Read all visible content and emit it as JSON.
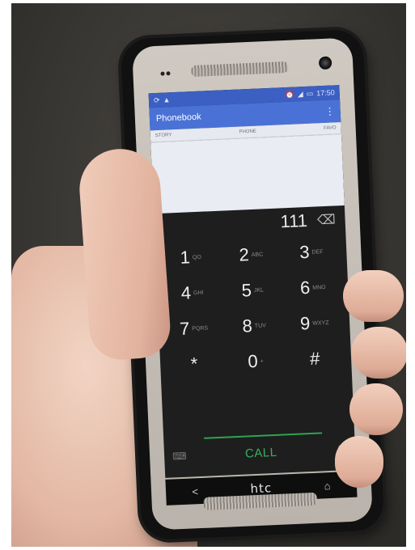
{
  "status_bar": {
    "left_icons": [
      "sync-icon",
      "warning-icon"
    ],
    "time": "17:50"
  },
  "app": {
    "title": "Phonebook",
    "menu_icon": "overflow-icon"
  },
  "tabs": [
    "STORY",
    "PHONE",
    "FAVO"
  ],
  "dialer": {
    "entered_number": "111",
    "keys": [
      {
        "num": "1",
        "letters": "QO"
      },
      {
        "num": "2",
        "letters": "ABC"
      },
      {
        "num": "3",
        "letters": "DEF"
      },
      {
        "num": "4",
        "letters": "GHI"
      },
      {
        "num": "5",
        "letters": "JKL"
      },
      {
        "num": "6",
        "letters": "MNO"
      },
      {
        "num": "7",
        "letters": "PQRS"
      },
      {
        "num": "8",
        "letters": "TUV"
      },
      {
        "num": "9",
        "letters": "WXYZ"
      },
      {
        "num": "*",
        "letters": ""
      },
      {
        "num": "0",
        "letters": "+"
      },
      {
        "num": "#",
        "letters": ""
      }
    ],
    "call_label": "CALL"
  },
  "nav": {
    "back": "<",
    "logo": "htc",
    "home": "⌂"
  },
  "colors": {
    "status_bar": "#3b5fc2",
    "app_bar": "#4a72d6",
    "call_accent": "#36b05c"
  }
}
